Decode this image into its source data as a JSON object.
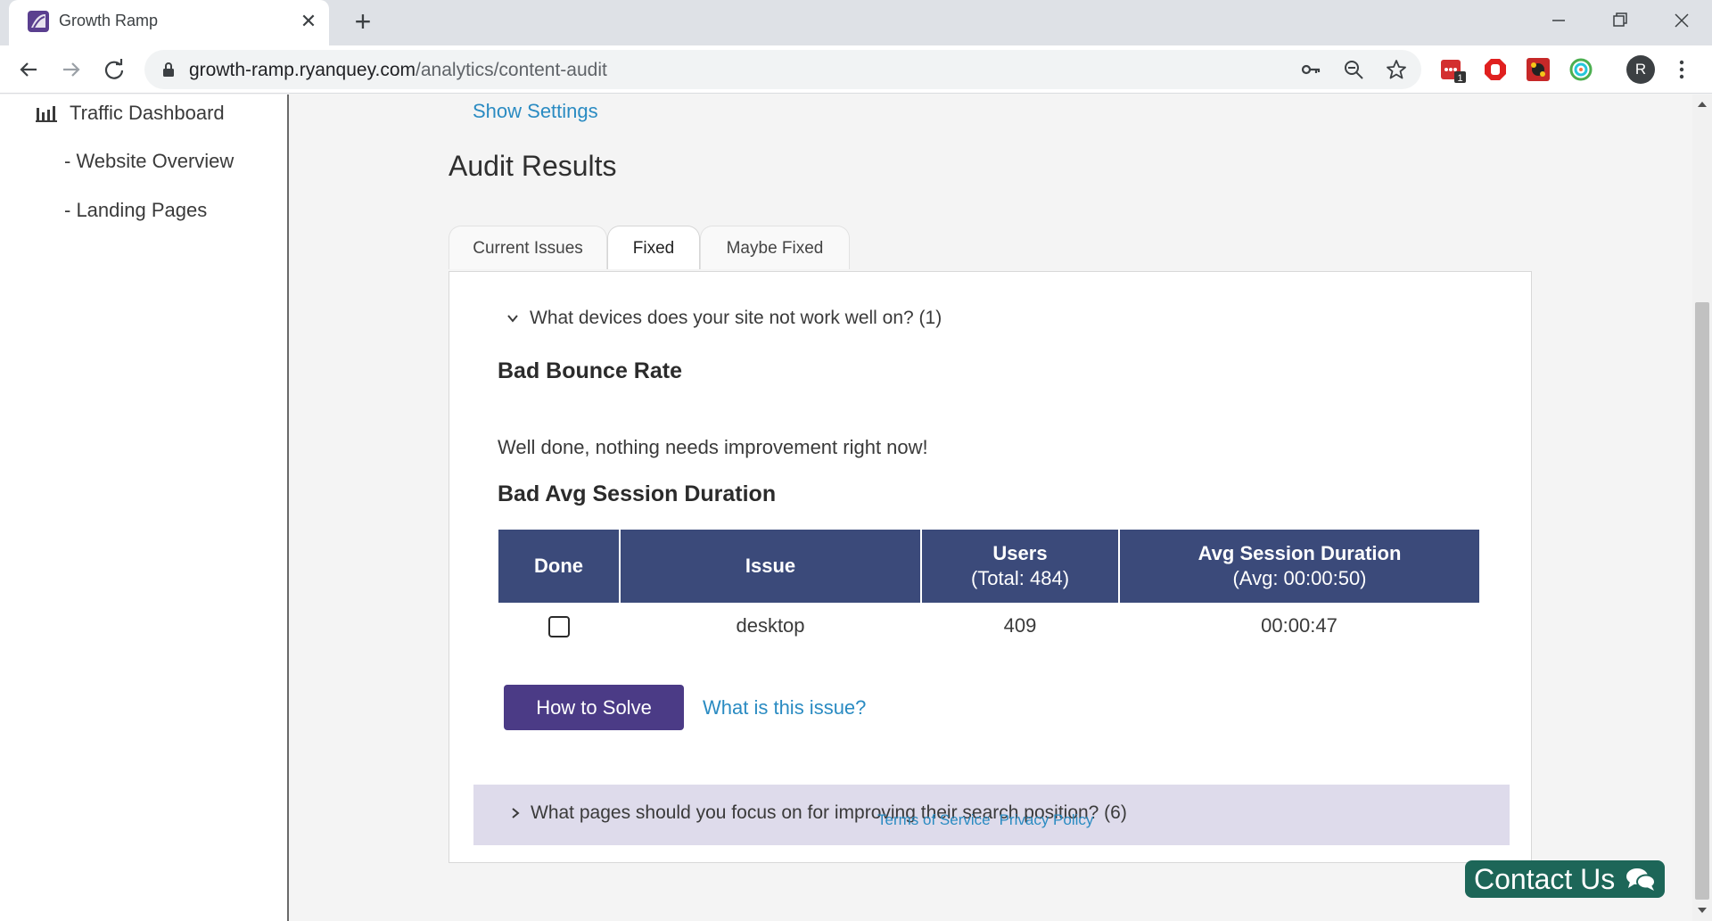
{
  "browser": {
    "tab_title": "Growth Ramp",
    "url_host": "growth-ramp.ryanquey.com",
    "url_path": "/analytics/content-audit",
    "profile_initial": "R",
    "extension_badge": "1"
  },
  "sidebar": {
    "main_item": "Traffic Dashboard",
    "sub_items": [
      "- Website Overview",
      "- Landing Pages"
    ]
  },
  "page": {
    "show_settings": "Show Settings",
    "title": "Audit Results",
    "tabs": [
      "Current Issues",
      "Fixed",
      "Maybe Fixed"
    ],
    "active_tab": "Fixed",
    "question_expanded": "What devices does your site not work well on? (1)",
    "bounce_heading": "Bad Bounce Rate",
    "bounce_message": "Well done, nothing needs improvement right now!",
    "session_heading": "Bad Avg Session Duration",
    "table": {
      "col_done": "Done",
      "col_issue": "Issue",
      "col_users": "Users",
      "col_users_sub": "(Total: 484)",
      "col_duration": "Avg Session Duration",
      "col_duration_sub": "(Avg: 00:00:50)",
      "rows": [
        {
          "done": false,
          "issue": "desktop",
          "users": "409",
          "duration": "00:00:47"
        }
      ]
    },
    "solve_button": "How to Solve",
    "what_link": "What is this issue?",
    "question_collapsed": "What pages should you focus on for improving their search position? (6)"
  },
  "footer": {
    "terms": "Terms of Service",
    "privacy": "Privacy Policy"
  },
  "contact": {
    "label": "Contact Us"
  },
  "colors": {
    "table_header": "#3b4a7a",
    "solve_button": "#4b3b86",
    "link": "#2a8bc2",
    "contact": "#1d6658",
    "collapsed_bar": "#dedbeb"
  }
}
